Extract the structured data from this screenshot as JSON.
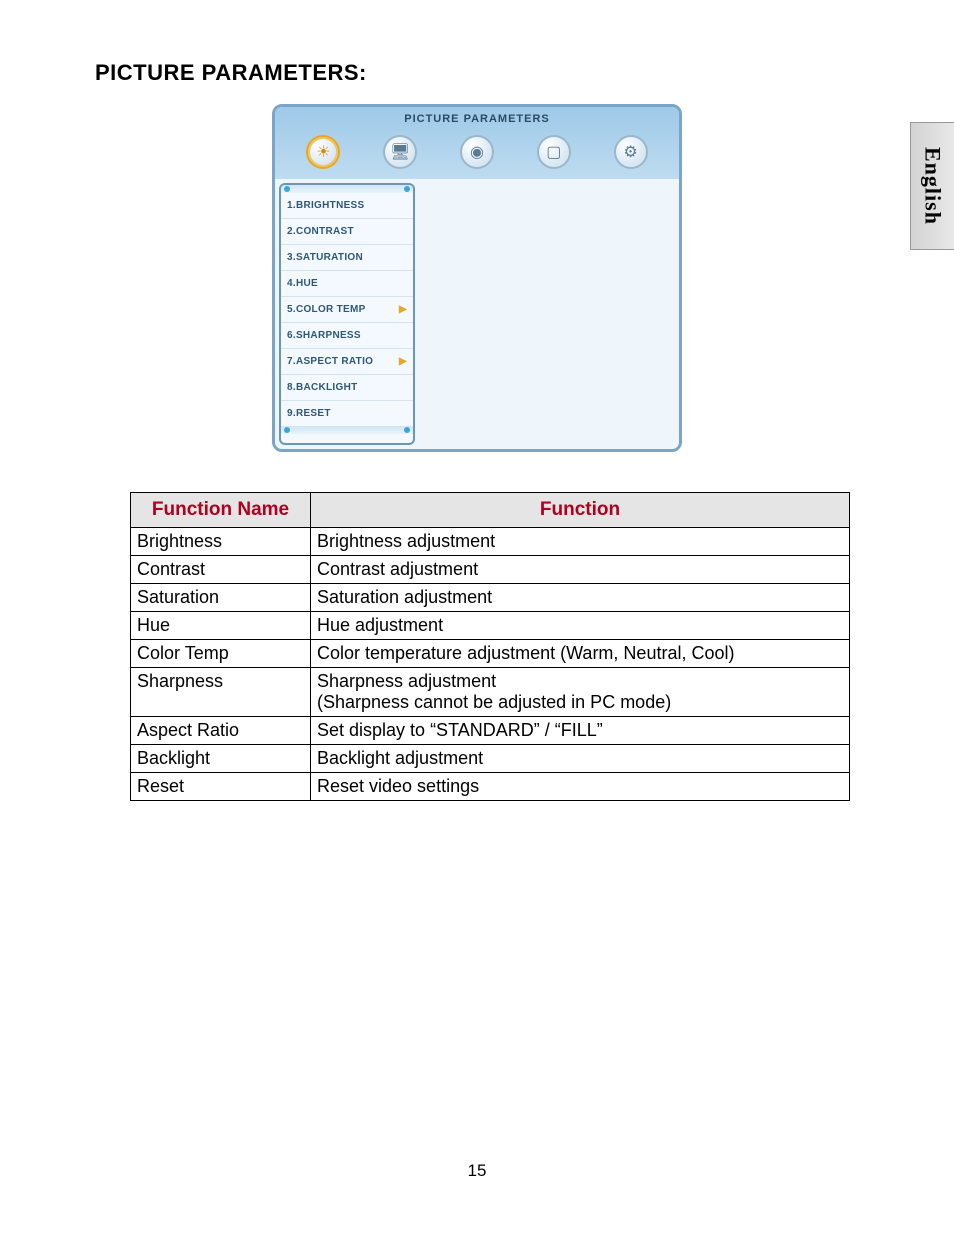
{
  "heading": "PICTURE PARAMETERS:",
  "language_tab": "English",
  "page_number": "15",
  "osd": {
    "title": "PICTURE PARAMETERS",
    "tabs": [
      {
        "name": "picture-icon",
        "glyph": "☀",
        "active": true
      },
      {
        "name": "pc-icon",
        "glyph": "🖥",
        "active": false
      },
      {
        "name": "audio-icon",
        "glyph": "◉",
        "active": false
      },
      {
        "name": "screen-icon",
        "glyph": "▢",
        "active": false
      },
      {
        "name": "setup-icon",
        "glyph": "⚙",
        "active": false
      }
    ],
    "menu": [
      {
        "label": "1.BRIGHTNESS",
        "arrow": false
      },
      {
        "label": "2.CONTRAST",
        "arrow": false
      },
      {
        "label": "3.SATURATION",
        "arrow": false
      },
      {
        "label": "4.HUE",
        "arrow": false
      },
      {
        "label": "5.COLOR TEMP",
        "arrow": true
      },
      {
        "label": "6.SHARPNESS",
        "arrow": false
      },
      {
        "label": "7.ASPECT RATIO",
        "arrow": true
      },
      {
        "label": "8.BACKLIGHT",
        "arrow": false
      },
      {
        "label": "9.RESET",
        "arrow": false
      }
    ]
  },
  "table": {
    "headers": {
      "name": "Function Name",
      "desc": "Function"
    },
    "rows": [
      {
        "name": "Brightness",
        "desc": "Brightness adjustment"
      },
      {
        "name": "Contrast",
        "desc": "Contrast adjustment"
      },
      {
        "name": "Saturation",
        "desc": "Saturation adjustment"
      },
      {
        "name": "Hue",
        "desc": "Hue adjustment"
      },
      {
        "name": "Color Temp",
        "desc": "Color temperature adjustment (Warm, Neutral, Cool)"
      },
      {
        "name": "Sharpness",
        "desc": "Sharpness adjustment\n(Sharpness cannot be adjusted in PC mode)"
      },
      {
        "name": "Aspect Ratio",
        "desc": "Set display to “STANDARD” / “FILL”"
      },
      {
        "name": "Backlight",
        "desc": "Backlight adjustment"
      },
      {
        "name": "Reset",
        "desc": "Reset video settings"
      }
    ]
  }
}
